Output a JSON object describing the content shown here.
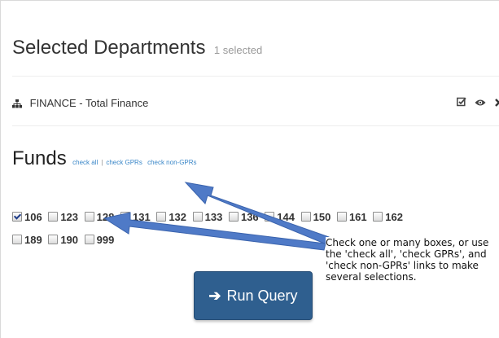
{
  "selected_departments": {
    "title": "Selected Departments",
    "count_label": "1 selected",
    "items": [
      {
        "label": "FINANCE - Total Finance",
        "icon": "sitemap-icon"
      }
    ],
    "actions": [
      "checkbox-icon",
      "eye-icon",
      "close-icon"
    ]
  },
  "funds": {
    "title": "Funds",
    "links": {
      "check_all": "check all",
      "separator": "|",
      "check_gprs": "check GPRs",
      "check_non_gprs": "check non-GPRs"
    },
    "row1": [
      {
        "label": "106",
        "checked": true
      },
      {
        "label": "123",
        "checked": false
      },
      {
        "label": "128",
        "checked": false
      },
      {
        "label": "131",
        "checked": false
      },
      {
        "label": "132",
        "checked": false
      },
      {
        "label": "133",
        "checked": false
      },
      {
        "label": "136",
        "checked": false
      },
      {
        "label": "144",
        "checked": false
      },
      {
        "label": "150",
        "checked": false
      },
      {
        "label": "161",
        "checked": false
      },
      {
        "label": "162",
        "checked": false
      }
    ],
    "row2": [
      {
        "label": "189",
        "checked": false
      },
      {
        "label": "190",
        "checked": false
      },
      {
        "label": "999",
        "checked": false
      }
    ]
  },
  "run_query": {
    "label": "Run Query",
    "icon": "arrow-right-icon"
  },
  "callout": {
    "text": "Check one or many boxes, or use the 'check all', 'check GPRs', and 'check non-GPRs' links to make several selections.",
    "arrow_color": "#4f7ac7"
  }
}
